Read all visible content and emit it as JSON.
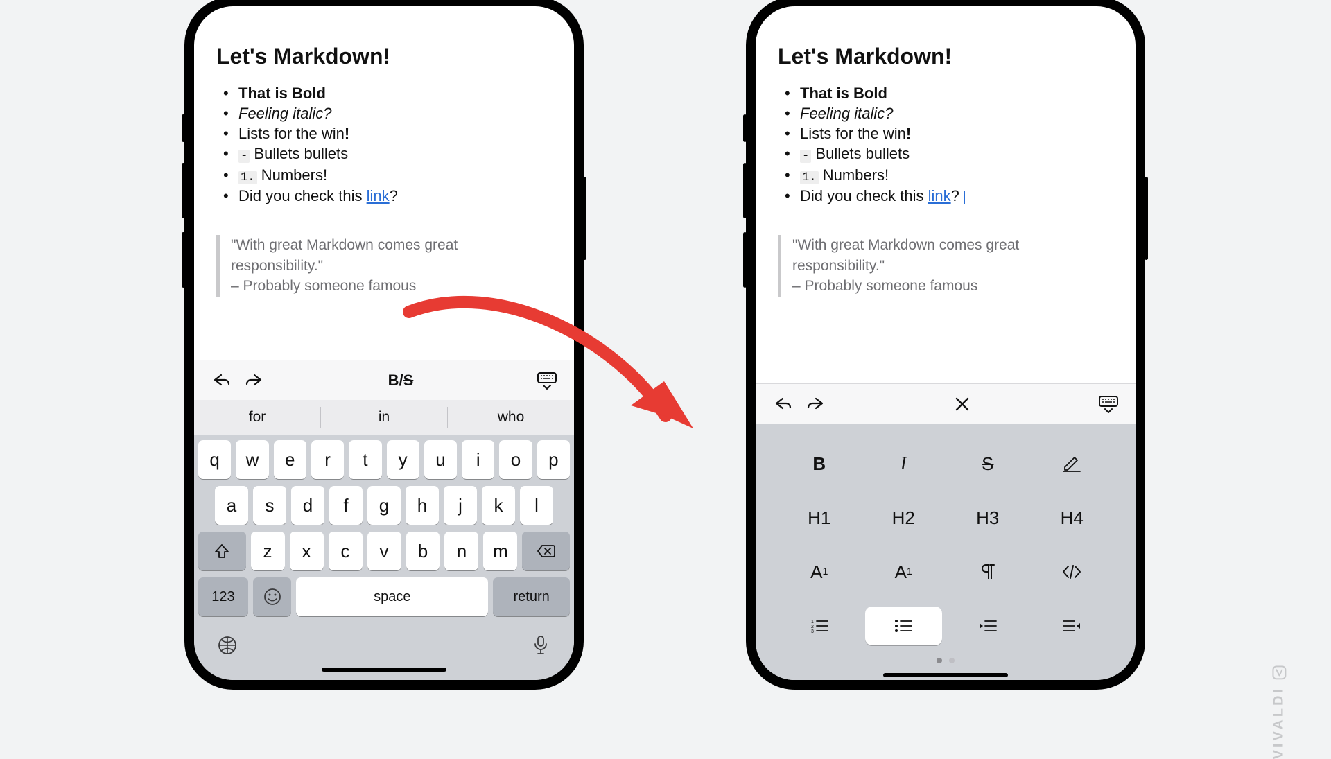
{
  "note": {
    "title": "Let's Markdown!",
    "items": {
      "bold": "That is Bold",
      "italic": "Feeling italic?",
      "lists_pre": "Lists for the win",
      "lists_bang": "!",
      "bullets_sym": "-",
      "bullets_txt": " Bullets bullets",
      "numbers_sym": "1.",
      "numbers_txt": " Numbers!",
      "link_pre": "Did you check this ",
      "link_txt": "link",
      "link_post": "?"
    },
    "quote_line1": "\"With great Markdown comes great responsibility.\"",
    "quote_line2": "– Probably someone famous"
  },
  "toolbar": {
    "style_b": "B",
    "style_slash": "/",
    "style_s": "S"
  },
  "suggestions": [
    "for",
    "in",
    "who"
  ],
  "keys": {
    "r1": [
      "q",
      "w",
      "e",
      "r",
      "t",
      "y",
      "u",
      "i",
      "o",
      "p"
    ],
    "r2": [
      "a",
      "s",
      "d",
      "f",
      "g",
      "h",
      "j",
      "k",
      "l"
    ],
    "r3": [
      "z",
      "x",
      "c",
      "v",
      "b",
      "n",
      "m"
    ],
    "num": "123",
    "space": "space",
    "ret": "return"
  },
  "md": {
    "bold": "B",
    "italic": "I",
    "strike": "S",
    "h1": "H1",
    "h2": "H2",
    "h3": "H3",
    "h4": "H4",
    "sub": "A",
    "sub_s": "1",
    "sup": "A",
    "sup_s": "1"
  },
  "watermark": "VIVALDI"
}
